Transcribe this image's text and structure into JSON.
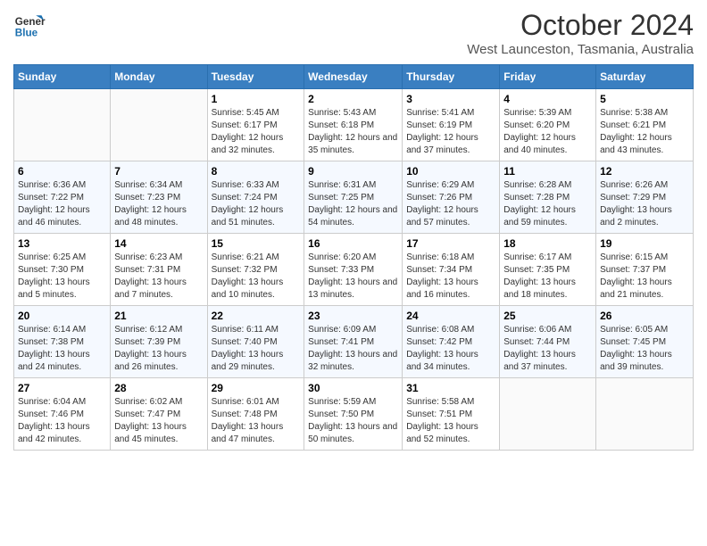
{
  "header": {
    "logo_general": "General",
    "logo_blue": "Blue",
    "main_title": "October 2024",
    "subtitle": "West Launceston, Tasmania, Australia"
  },
  "days_of_week": [
    "Sunday",
    "Monday",
    "Tuesday",
    "Wednesday",
    "Thursday",
    "Friday",
    "Saturday"
  ],
  "weeks": [
    [
      {
        "num": "",
        "info": ""
      },
      {
        "num": "",
        "info": ""
      },
      {
        "num": "1",
        "info": "Sunrise: 5:45 AM\nSunset: 6:17 PM\nDaylight: 12 hours and 32 minutes."
      },
      {
        "num": "2",
        "info": "Sunrise: 5:43 AM\nSunset: 6:18 PM\nDaylight: 12 hours and 35 minutes."
      },
      {
        "num": "3",
        "info": "Sunrise: 5:41 AM\nSunset: 6:19 PM\nDaylight: 12 hours and 37 minutes."
      },
      {
        "num": "4",
        "info": "Sunrise: 5:39 AM\nSunset: 6:20 PM\nDaylight: 12 hours and 40 minutes."
      },
      {
        "num": "5",
        "info": "Sunrise: 5:38 AM\nSunset: 6:21 PM\nDaylight: 12 hours and 43 minutes."
      }
    ],
    [
      {
        "num": "6",
        "info": "Sunrise: 6:36 AM\nSunset: 7:22 PM\nDaylight: 12 hours and 46 minutes."
      },
      {
        "num": "7",
        "info": "Sunrise: 6:34 AM\nSunset: 7:23 PM\nDaylight: 12 hours and 48 minutes."
      },
      {
        "num": "8",
        "info": "Sunrise: 6:33 AM\nSunset: 7:24 PM\nDaylight: 12 hours and 51 minutes."
      },
      {
        "num": "9",
        "info": "Sunrise: 6:31 AM\nSunset: 7:25 PM\nDaylight: 12 hours and 54 minutes."
      },
      {
        "num": "10",
        "info": "Sunrise: 6:29 AM\nSunset: 7:26 PM\nDaylight: 12 hours and 57 minutes."
      },
      {
        "num": "11",
        "info": "Sunrise: 6:28 AM\nSunset: 7:28 PM\nDaylight: 12 hours and 59 minutes."
      },
      {
        "num": "12",
        "info": "Sunrise: 6:26 AM\nSunset: 7:29 PM\nDaylight: 13 hours and 2 minutes."
      }
    ],
    [
      {
        "num": "13",
        "info": "Sunrise: 6:25 AM\nSunset: 7:30 PM\nDaylight: 13 hours and 5 minutes."
      },
      {
        "num": "14",
        "info": "Sunrise: 6:23 AM\nSunset: 7:31 PM\nDaylight: 13 hours and 7 minutes."
      },
      {
        "num": "15",
        "info": "Sunrise: 6:21 AM\nSunset: 7:32 PM\nDaylight: 13 hours and 10 minutes."
      },
      {
        "num": "16",
        "info": "Sunrise: 6:20 AM\nSunset: 7:33 PM\nDaylight: 13 hours and 13 minutes."
      },
      {
        "num": "17",
        "info": "Sunrise: 6:18 AM\nSunset: 7:34 PM\nDaylight: 13 hours and 16 minutes."
      },
      {
        "num": "18",
        "info": "Sunrise: 6:17 AM\nSunset: 7:35 PM\nDaylight: 13 hours and 18 minutes."
      },
      {
        "num": "19",
        "info": "Sunrise: 6:15 AM\nSunset: 7:37 PM\nDaylight: 13 hours and 21 minutes."
      }
    ],
    [
      {
        "num": "20",
        "info": "Sunrise: 6:14 AM\nSunset: 7:38 PM\nDaylight: 13 hours and 24 minutes."
      },
      {
        "num": "21",
        "info": "Sunrise: 6:12 AM\nSunset: 7:39 PM\nDaylight: 13 hours and 26 minutes."
      },
      {
        "num": "22",
        "info": "Sunrise: 6:11 AM\nSunset: 7:40 PM\nDaylight: 13 hours and 29 minutes."
      },
      {
        "num": "23",
        "info": "Sunrise: 6:09 AM\nSunset: 7:41 PM\nDaylight: 13 hours and 32 minutes."
      },
      {
        "num": "24",
        "info": "Sunrise: 6:08 AM\nSunset: 7:42 PM\nDaylight: 13 hours and 34 minutes."
      },
      {
        "num": "25",
        "info": "Sunrise: 6:06 AM\nSunset: 7:44 PM\nDaylight: 13 hours and 37 minutes."
      },
      {
        "num": "26",
        "info": "Sunrise: 6:05 AM\nSunset: 7:45 PM\nDaylight: 13 hours and 39 minutes."
      }
    ],
    [
      {
        "num": "27",
        "info": "Sunrise: 6:04 AM\nSunset: 7:46 PM\nDaylight: 13 hours and 42 minutes."
      },
      {
        "num": "28",
        "info": "Sunrise: 6:02 AM\nSunset: 7:47 PM\nDaylight: 13 hours and 45 minutes."
      },
      {
        "num": "29",
        "info": "Sunrise: 6:01 AM\nSunset: 7:48 PM\nDaylight: 13 hours and 47 minutes."
      },
      {
        "num": "30",
        "info": "Sunrise: 5:59 AM\nSunset: 7:50 PM\nDaylight: 13 hours and 50 minutes."
      },
      {
        "num": "31",
        "info": "Sunrise: 5:58 AM\nSunset: 7:51 PM\nDaylight: 13 hours and 52 minutes."
      },
      {
        "num": "",
        "info": ""
      },
      {
        "num": "",
        "info": ""
      }
    ]
  ]
}
